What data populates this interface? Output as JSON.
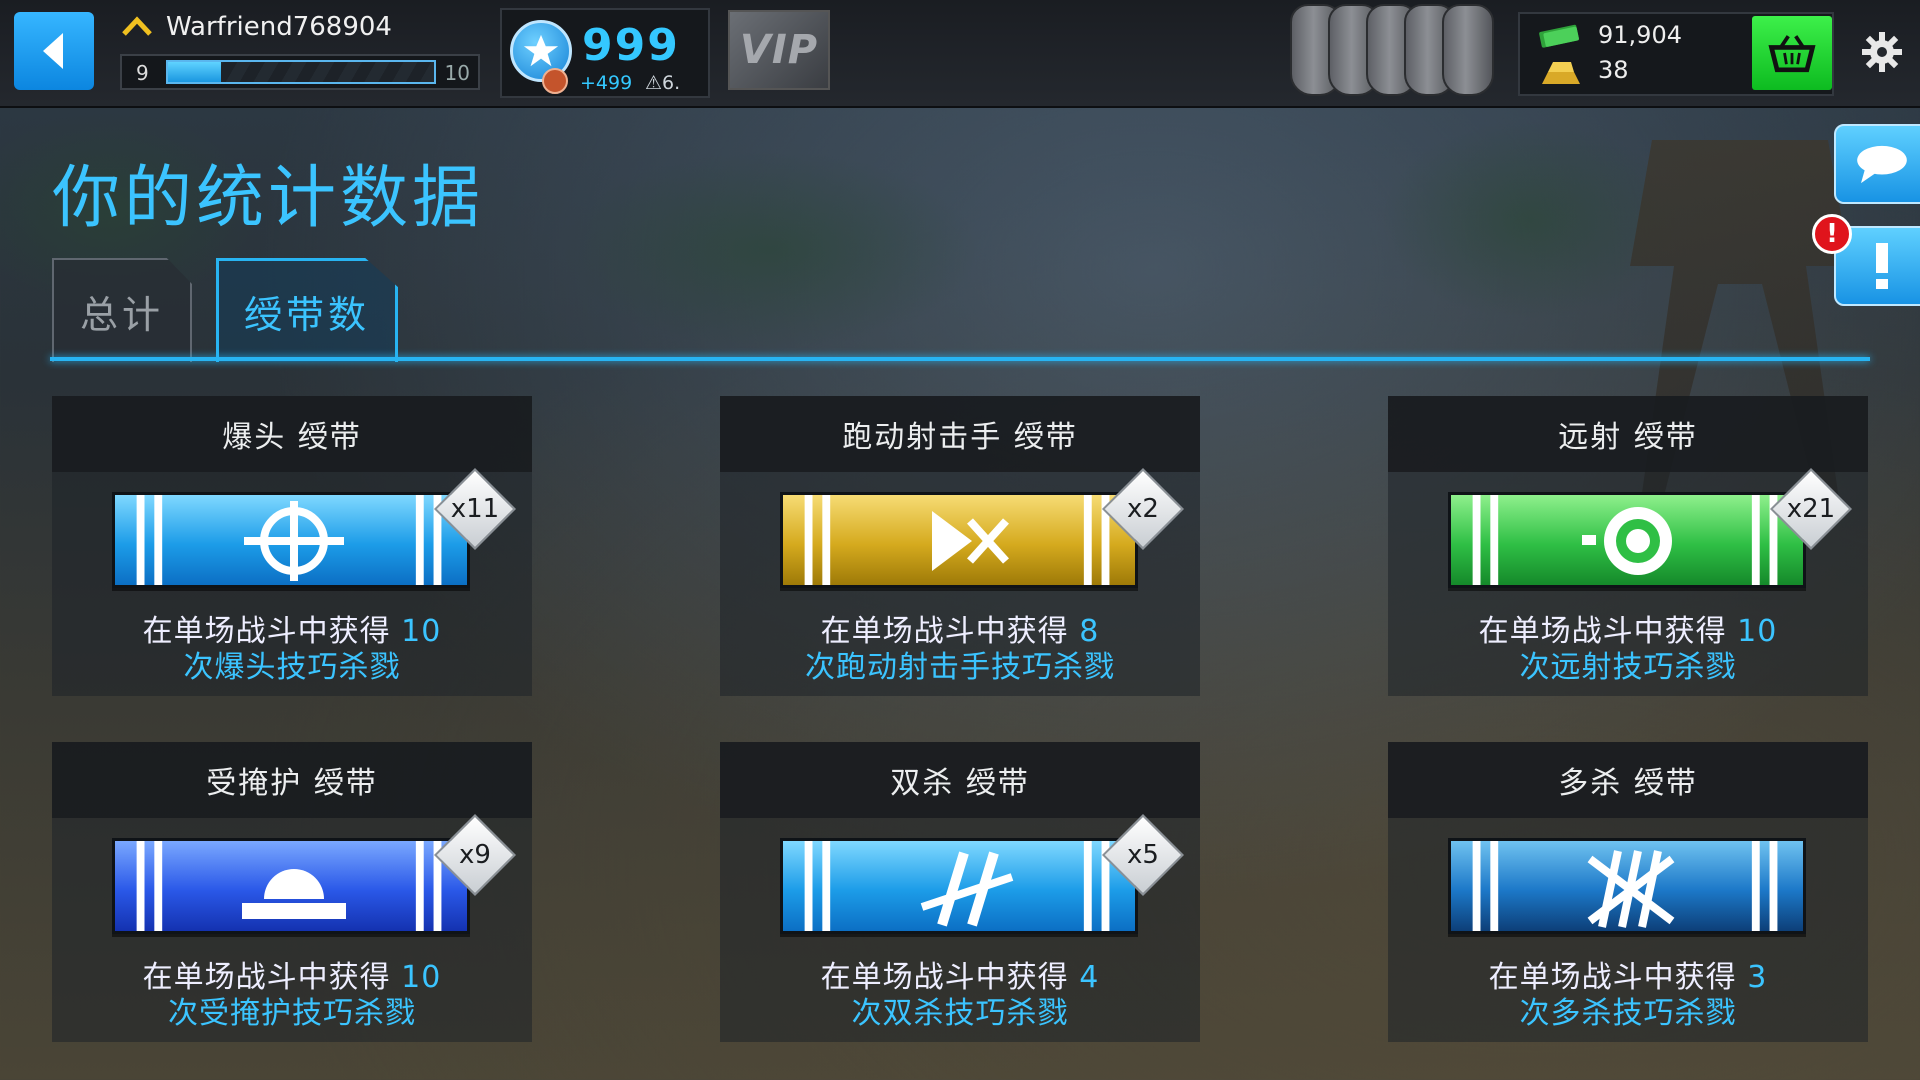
{
  "player": {
    "username": "Warfriend768904",
    "level_current": "9",
    "level_next": "10",
    "xp_progress": 0.2
  },
  "score": {
    "value": "999",
    "sub_gain": "+499",
    "sub_rank": "⚠6."
  },
  "vip_label": "VIP",
  "currency": {
    "cash": "91,904",
    "gold": "38"
  },
  "page_title": "你的统计数据",
  "tabs": [
    {
      "label": "总计",
      "active": false
    },
    {
      "label": "绶带数",
      "active": true
    }
  ],
  "colors": {
    "accent": "#28b4f2",
    "shop_green": "#15c82a",
    "alert_red": "#e0141c"
  },
  "ribbons": [
    {
      "title": "爆头 绶带",
      "count": "x11",
      "color": "blue",
      "icon": "crosshair-icon",
      "line1": "在单场战斗中获得",
      "n": "10",
      "line2": "次爆头技巧杀戮"
    },
    {
      "title": "跑动射击手 绶带",
      "count": "x2",
      "color": "gold",
      "icon": "run-and-gun-icon",
      "line1": "在单场战斗中获得",
      "n": "8",
      "line2": "次跑动射击手技巧杀戮"
    },
    {
      "title": "远射 绶带",
      "count": "x21",
      "color": "green",
      "icon": "target-icon",
      "line1": "在单场战斗中获得",
      "n": "10",
      "line2": "次远射技巧杀戮"
    },
    {
      "title": "受掩护 绶带",
      "count": "x9",
      "color": "royal",
      "icon": "helmet-cover-icon",
      "line1": "在单场战斗中获得",
      "n": "10",
      "line2": "次受掩护技巧杀戮"
    },
    {
      "title": "双杀 绶带",
      "count": "x5",
      "color": "blue",
      "icon": "double-kill-icon",
      "line1": "在单场战斗中获得",
      "n": "4",
      "line2": "次双杀技巧杀戮"
    },
    {
      "title": "多杀 绶带",
      "count": "",
      "color": "navy",
      "icon": "multi-kill-icon",
      "line1": "在单场战斗中获得",
      "n": "3",
      "line2": "次多杀技巧杀戮"
    }
  ]
}
